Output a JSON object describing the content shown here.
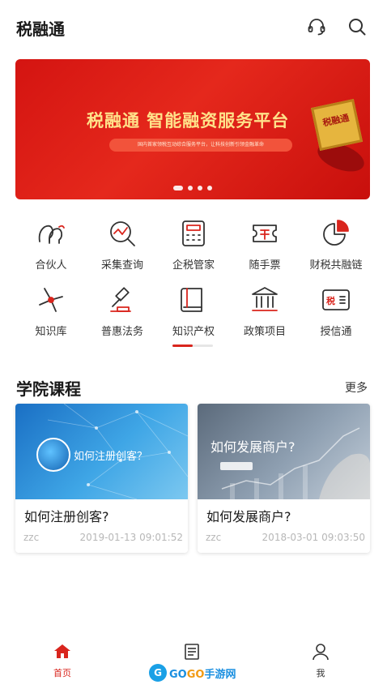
{
  "header": {
    "title": "税融通",
    "icons": [
      "headset-icon",
      "search-icon"
    ]
  },
  "banner": {
    "title": "税融通 智能融资服务平台",
    "subtitle": "国内首家领税互动综合服务平台，让科技创新引领金融革命",
    "seal_text": "税融通",
    "dots": 4,
    "active_dot": 0
  },
  "grid": {
    "items": [
      {
        "label": "合伙人",
        "icon": "partner-icon"
      },
      {
        "label": "采集查询",
        "icon": "data-query-icon"
      },
      {
        "label": "企税管家",
        "icon": "calculator-icon"
      },
      {
        "label": "随手票",
        "icon": "ticket-icon"
      },
      {
        "label": "财税共融链",
        "icon": "pie-chart-icon"
      },
      {
        "label": "知识库",
        "icon": "knowledge-icon"
      },
      {
        "label": "普惠法务",
        "icon": "gavel-icon"
      },
      {
        "label": "知识产权",
        "icon": "book-icon"
      },
      {
        "label": "政策项目",
        "icon": "bank-icon"
      },
      {
        "label": "授信通",
        "icon": "tax-card-icon"
      }
    ],
    "tax_card_text": "税",
    "page_progress": 0.5
  },
  "courses": {
    "title": "学院课程",
    "more": "更多",
    "items": [
      {
        "title": "如何注册创客?",
        "image_text": "如何注册创客？",
        "author": "zzc",
        "date": "2019-01-13 09:01:52"
      },
      {
        "title": "如何发展商户?",
        "image_text": "如何发展商户?",
        "author": "zzc",
        "date": "2018-03-01 09:03:50"
      }
    ]
  },
  "bottom_nav": {
    "items": [
      {
        "label": "首页",
        "icon": "home-icon",
        "active": true
      },
      {
        "label": "",
        "icon": "news-icon",
        "active": false
      },
      {
        "label": "我",
        "icon": "user-icon",
        "active": false
      }
    ],
    "active_color": "#d9251d"
  },
  "watermark": {
    "circle": "G",
    "text_a": "GO",
    "text_b": "GO",
    "text_c": "手游网"
  },
  "colors": {
    "accent": "#d9251d",
    "banner_red": "#e02019",
    "gold": "#ffe28a"
  }
}
